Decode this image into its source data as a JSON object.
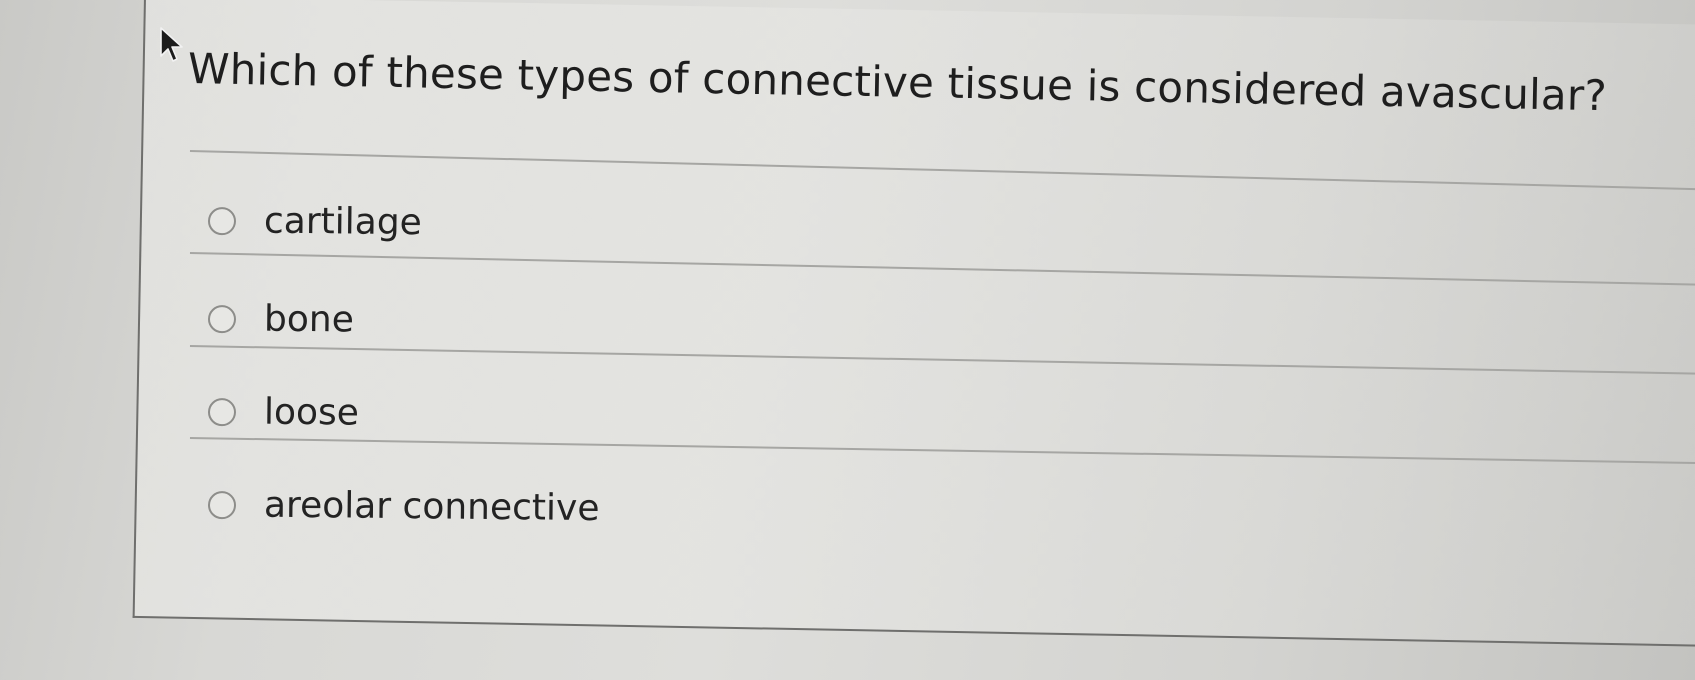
{
  "question": {
    "text": "Which of these types of connective tissue is considered avascular?"
  },
  "options": [
    {
      "label": "cartilage"
    },
    {
      "label": "bone"
    },
    {
      "label": "loose"
    },
    {
      "label": "areolar connective"
    }
  ],
  "icons": {
    "cursor": "mouse-pointer-icon",
    "radio": "radio-button-icon"
  },
  "colors": {
    "text": "#1e1e1e",
    "divider": "#a6a6a3",
    "radio_border": "#8d8d8a"
  }
}
